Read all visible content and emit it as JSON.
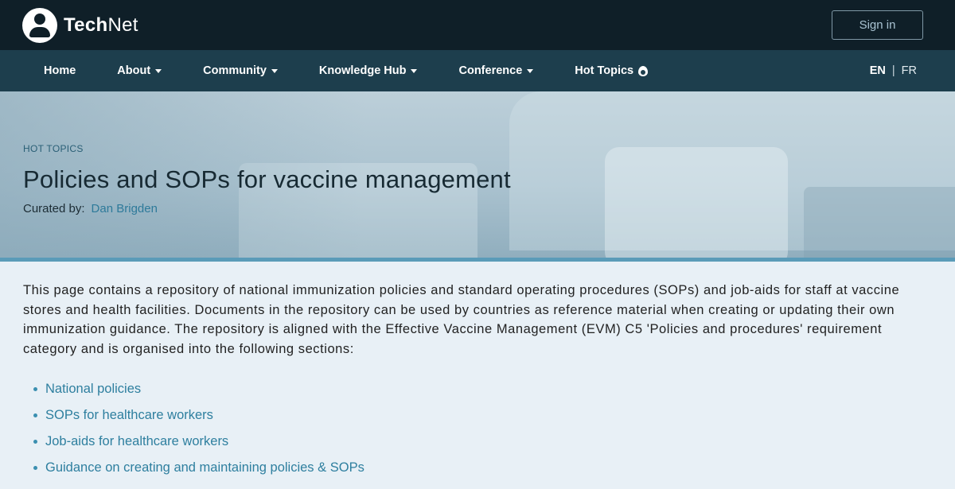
{
  "header": {
    "brand_bold": "Tech",
    "brand_rest": "Net",
    "signin_label": "Sign in"
  },
  "nav": {
    "items": [
      {
        "label": "Home",
        "caret": false
      },
      {
        "label": "About",
        "caret": true
      },
      {
        "label": "Community",
        "caret": true
      },
      {
        "label": "Knowledge Hub",
        "caret": true
      },
      {
        "label": "Conference",
        "caret": true
      },
      {
        "label": "Hot Topics",
        "icon": "flame-icon"
      }
    ],
    "lang": {
      "en": "EN",
      "separator": "|",
      "fr": "FR"
    }
  },
  "hero": {
    "kicker": "HOT TOPICS",
    "title": "Policies and SOPs for vaccine management",
    "curated_label": "Curated by:",
    "curator": "Dan Brigden"
  },
  "main": {
    "intro": "This page contains a repository of national immunization policies and standard operating procedures (SOPs) and job-aids for staff at vaccine stores and health facilities. Documents in the repository can be used by countries as reference material when creating or updating their own immunization guidance. The repository is aligned with the Effective Vaccine Management (EVM) C5 'Policies and procedures' requirement category and is organised into the following sections:",
    "sections": [
      "National policies",
      "SOPs for healthcare workers",
      "Job-aids for healthcare workers",
      "Guidance on creating and maintaining policies & SOPs"
    ]
  },
  "colors": {
    "topbar": "#0f1f28",
    "nav": "#1d3e4d",
    "link": "#2e7f9f",
    "accent_rule": "#5a9bb8"
  }
}
